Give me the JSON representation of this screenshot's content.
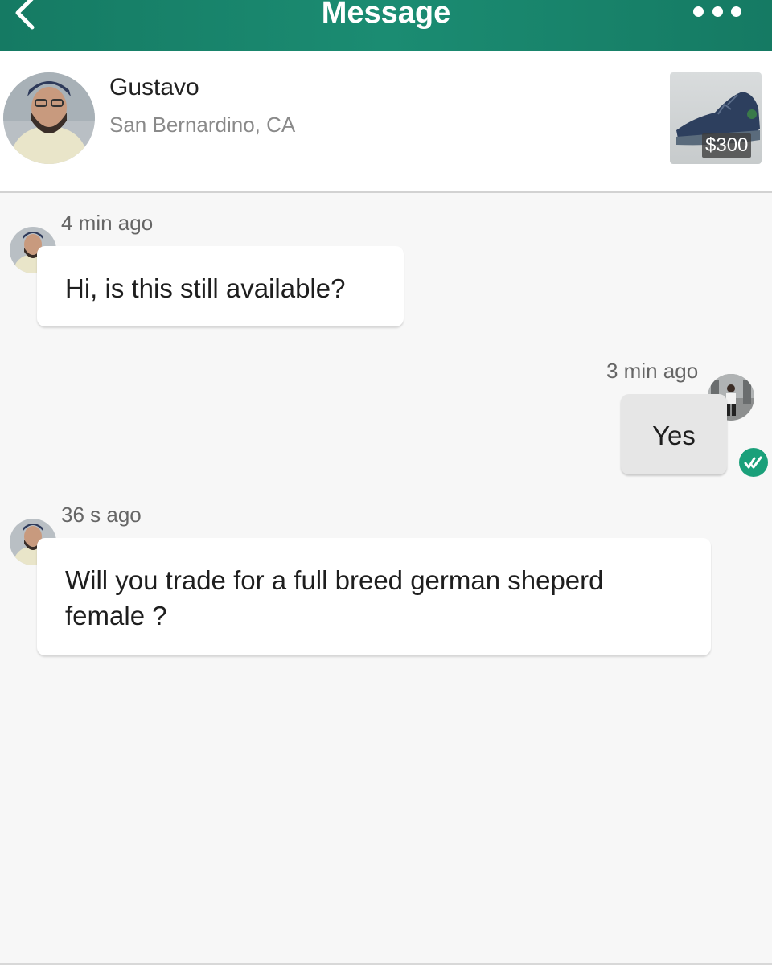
{
  "header": {
    "title": "Message",
    "back_icon": "chevron-left-icon",
    "more_icon": "more-dots-icon",
    "accent_color": "#1b8c72"
  },
  "contact": {
    "name": "Gustavo",
    "location": "San Bernardino, CA"
  },
  "listing": {
    "price": "$300"
  },
  "messages": [
    {
      "direction": "incoming",
      "time": "4 min ago",
      "text": "Hi, is this still available?"
    },
    {
      "direction": "outgoing",
      "time": "3 min ago",
      "text": "Yes",
      "status_icon": "double-check-icon"
    },
    {
      "direction": "incoming",
      "time": "36 s ago",
      "text": "Will you trade for a full breed german sheperd female ?"
    }
  ]
}
